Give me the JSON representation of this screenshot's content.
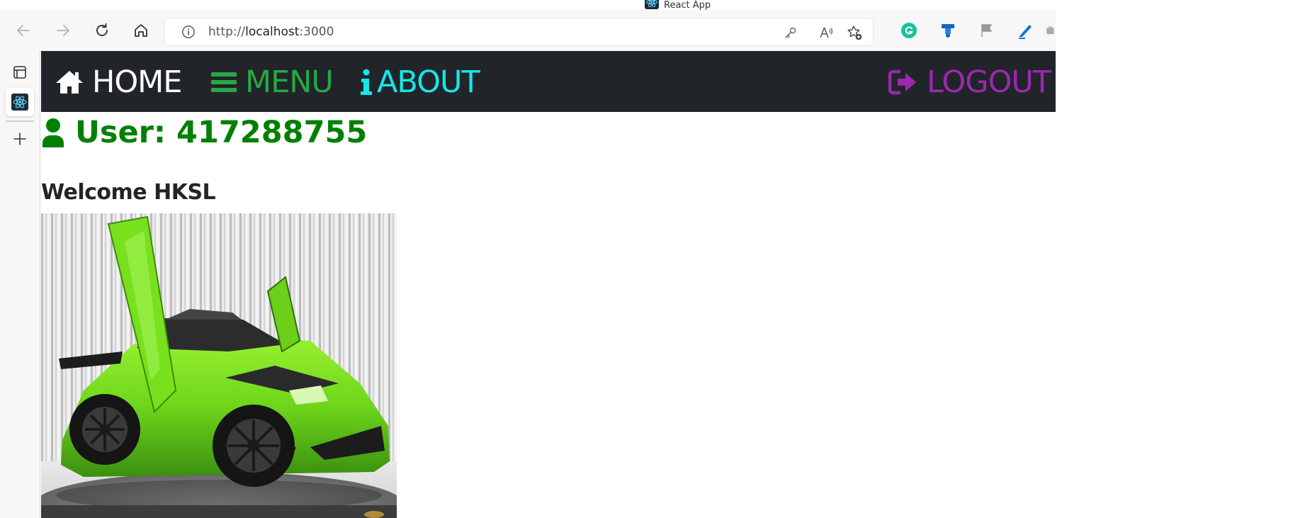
{
  "browser": {
    "tab_title": "React App",
    "address": {
      "scheme": "http://",
      "host": "localhost",
      "port": ":3000"
    },
    "icons": {
      "back": "back-arrow-icon",
      "forward": "forward-arrow-icon",
      "refresh": "refresh-icon",
      "home": "home-icon",
      "site_info": "info-icon",
      "password": "key-icon",
      "read_aloud": "read-aloud-icon",
      "favorite": "add-favorite-icon"
    },
    "extensions": [
      "grammarly-icon",
      "extension-badge-icon",
      "flag-icon",
      "pen-icon",
      "extension-icon"
    ],
    "side_rail": [
      "tab-actions-icon",
      "react-tab-icon",
      "new-tab-plus-icon"
    ]
  },
  "nav": {
    "home_label": "HOME",
    "menu_label": "MENU",
    "about_label": "ABOUT",
    "logout_label": "LOGOUT",
    "colors": {
      "background": "#212529",
      "home": "#ffffff",
      "menu": "#28a745",
      "about": "#17e6e6",
      "logout": "#9c27b0"
    }
  },
  "main": {
    "user_title": "User: 417288755",
    "welcome_text": "Welcome HKSL",
    "image_alt": "Green sports car with scissor doors open"
  }
}
